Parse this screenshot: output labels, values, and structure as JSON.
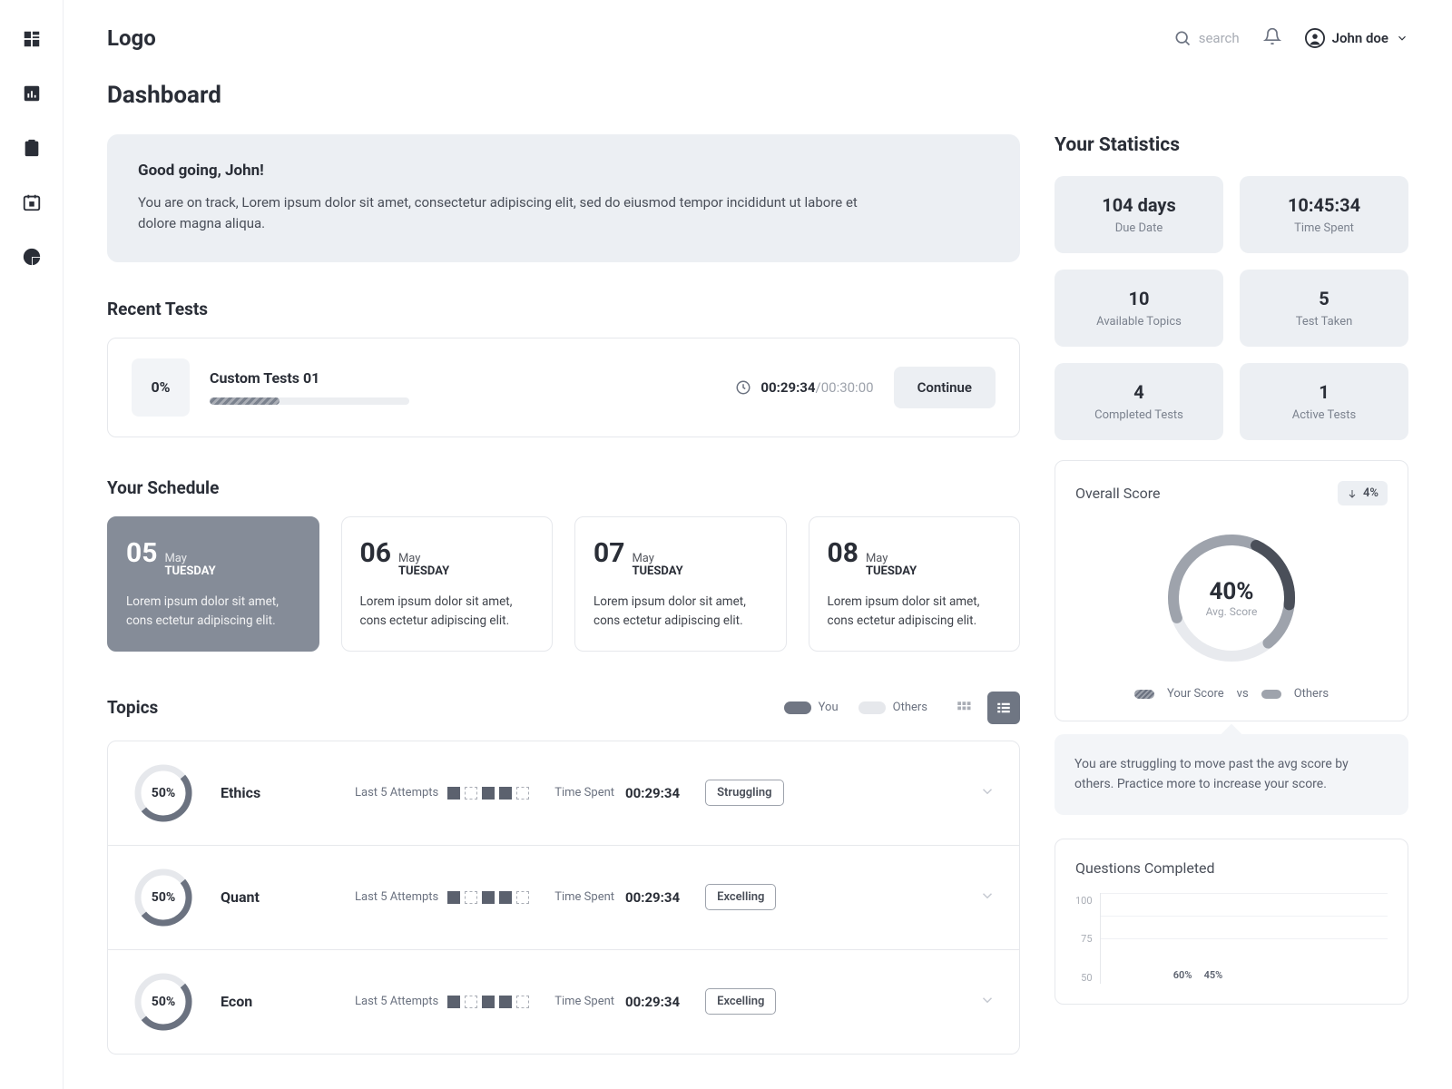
{
  "logo": "Logo",
  "search_placeholder": "search",
  "user_name": "John doe",
  "page_title": "Dashboard",
  "greeting": {
    "title": "Good going, John!",
    "text": "You are on track, Lorem ipsum dolor sit amet, consectetur adipiscing elit, sed do eiusmod tempor incididunt ut labore et dolore magna aliqua."
  },
  "recent_tests_title": "Recent Tests",
  "recent_test": {
    "pct": "0%",
    "name": "Custom Tests 01",
    "time": "00:29:34",
    "limit": "/00:30:00",
    "progress_pct": 35,
    "continue": "Continue"
  },
  "schedule_title": "Your Schedule",
  "schedule": [
    {
      "day": "05",
      "month": "May",
      "dow": "TUESDAY",
      "text": "Lorem ipsum dolor sit amet, cons ectetur adipiscing elit."
    },
    {
      "day": "06",
      "month": "May",
      "dow": "TUESDAY",
      "text": "Lorem ipsum dolor sit amet, cons ectetur adipiscing elit."
    },
    {
      "day": "07",
      "month": "May",
      "dow": "TUESDAY",
      "text": "Lorem ipsum dolor sit amet, cons ectetur adipiscing elit."
    },
    {
      "day": "08",
      "month": "May",
      "dow": "TUESDAY",
      "text": "Lorem ipsum dolor sit amet, cons ectetur adipiscing elit."
    }
  ],
  "topics_title": "Topics",
  "legend_you": "You",
  "legend_others": "Others",
  "attempts_label": "Last 5 Attempts",
  "time_spent_label": "Time Spent",
  "topics": [
    {
      "pct": "50%",
      "name": "Ethics",
      "attempts": [
        1,
        0,
        1,
        1,
        0
      ],
      "time": "00:29:34",
      "status": "Struggling"
    },
    {
      "pct": "50%",
      "name": "Quant",
      "attempts": [
        1,
        0,
        1,
        1,
        0
      ],
      "time": "00:29:34",
      "status": "Excelling"
    },
    {
      "pct": "50%",
      "name": "Econ",
      "attempts": [
        1,
        0,
        1,
        1,
        0
      ],
      "time": "00:29:34",
      "status": "Excelling"
    }
  ],
  "stats_title": "Your Statistics",
  "stats": [
    {
      "val": "104 days",
      "label": "Due Date"
    },
    {
      "val": "10:45:34",
      "label": "Time Spent"
    },
    {
      "val": "10",
      "label": "Available Topics"
    },
    {
      "val": "5",
      "label": "Test Taken"
    },
    {
      "val": "4",
      "label": "Completed Tests"
    },
    {
      "val": "1",
      "label": "Active Tests"
    }
  ],
  "score": {
    "title": "Overall Score",
    "badge": "4%",
    "pct": "40%",
    "label": "Avg. Score",
    "legend_you": "Your Score",
    "legend_vs": "vs",
    "legend_others": "Others"
  },
  "tip_text": "You are struggling to move past the avg score by others. Practice more to increase your score.",
  "questions_title": "Questions Completed",
  "chart_data": {
    "type": "bar",
    "ylim": [
      0,
      100
    ],
    "yticks": [
      100,
      75,
      50
    ],
    "categories": [
      "",
      "",
      "",
      "",
      "",
      "",
      "",
      "",
      ""
    ],
    "values": [
      null,
      null,
      60,
      45,
      null,
      null,
      null,
      null,
      null
    ],
    "labels": [
      "",
      "",
      "60%",
      "45%",
      "",
      "",
      "",
      "",
      ""
    ]
  }
}
